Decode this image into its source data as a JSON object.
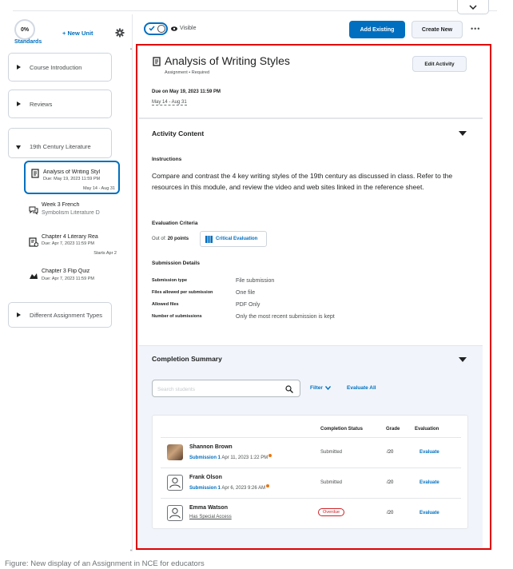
{
  "sidebar": {
    "progress_percent": "0%",
    "standards_label": "Standards",
    "new_unit_label": "+ New Unit",
    "units": [
      {
        "label": "Course Introduction"
      },
      {
        "label": "Reviews"
      },
      {
        "label": "19th Century Literature"
      },
      {
        "label": "Different Assignment Types"
      }
    ],
    "children": [
      {
        "title": "Analysis of Writing Styl",
        "due": "Due: May 19, 2023 11:59 PM",
        "date": "May 14 - Aug 31",
        "icon": "assignment-icon"
      },
      {
        "title": "Week 3 French",
        "title2": "Symbolism Literature D",
        "icon": "discussion-icon"
      },
      {
        "title": "Chapter 4 Literary Rea",
        "due": "Due: Apr 7, 2023 11:59 PM",
        "date": "Starts Apr 2",
        "icon": "assignment-hidden-icon"
      },
      {
        "title": "Chapter 3 Flip Quiz",
        "due": "Due: Apr 7, 2023 11:59 PM",
        "icon": "quiz-icon"
      }
    ]
  },
  "toolbar": {
    "visibility_label": "Visible",
    "add_existing_label": "Add Existing",
    "create_new_label": "Create New",
    "more_label": "•••"
  },
  "assignment": {
    "title": "Analysis of Writing Styles",
    "subtitle": "Assignment • Required",
    "edit_label": "Edit Activity",
    "due": "Due on May 19, 2023 11:59 PM",
    "date_range": "May 14 - Aug 31"
  },
  "activity_content": {
    "heading": "Activity Content",
    "instructions_heading": "Instructions",
    "instructions_text": "Compare and contrast the 4 key writing styles of the 19th century as discussed in class. Refer to the resources in this module, and review the video and web sites linked in the reference sheet.",
    "evaluation_heading": "Evaluation Criteria",
    "out_of_prefix": "Out of:",
    "out_of_value": "20 points",
    "rubric_label": "Critical Evaluation",
    "submission_heading": "Submission Details",
    "details": [
      {
        "key": "Submission type",
        "value": "File submission"
      },
      {
        "key": "Files allowed per submission",
        "value": "One file"
      },
      {
        "key": "Allowed files",
        "value": "PDF Only"
      },
      {
        "key": "Number of submissions",
        "value": "Only the most recent submission is kept"
      }
    ]
  },
  "completion": {
    "heading": "Completion Summary",
    "search_placeholder": "Search students",
    "filter_label": "Filter",
    "evaluate_all_label": "Evaluate All",
    "columns": [
      "Completion Status",
      "Grade",
      "Evaluation"
    ],
    "rows": [
      {
        "name": "Shannon Brown",
        "submission": "Submission 1",
        "date": "Apr 11, 2023 1:22 PM",
        "status": "Submitted",
        "grade": "/20",
        "action": "Evaluate"
      },
      {
        "name": "Frank Olson",
        "submission": "Submission 1",
        "date": "Apr 6, 2023 9:26 AM",
        "status": "Submitted",
        "grade": "/20",
        "action": "Evaluate"
      },
      {
        "name": "Emma Watson",
        "special": "Has Special Access",
        "status": "Overdue",
        "grade": "/20",
        "action": "Evaluate"
      }
    ]
  },
  "caption": "Figure: New display of an Assignment in NCE for educators",
  "colors": {
    "accent": "#006fbf",
    "highlight_frame": "#e00000",
    "overdue": "#cd2026",
    "notification_dot": "#e87511"
  }
}
